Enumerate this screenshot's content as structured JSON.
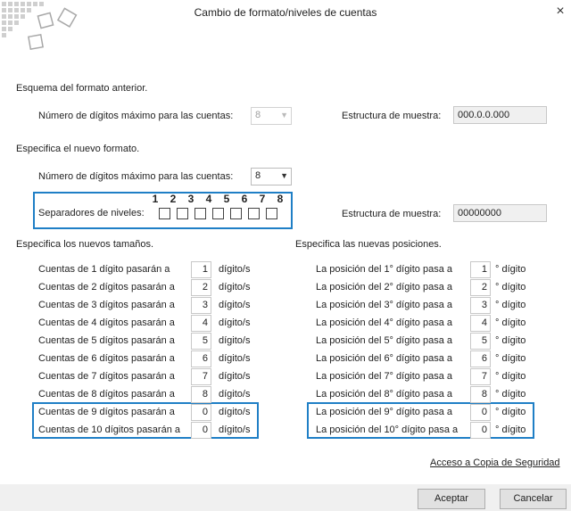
{
  "window": {
    "title": "Cambio de formato/niveles de cuentas",
    "close_glyph": "×"
  },
  "old_format": {
    "section_title": "Esquema del formato anterior.",
    "max_digits_label": "Número de dígitos máximo para las cuentas:",
    "max_digits_value": "8",
    "sample_label": "Estructura de muestra:",
    "sample_value": "000.0.0.000"
  },
  "new_format": {
    "section_title": "Especifica el nuevo formato.",
    "max_digits_label": "Número de dígitos máximo para las cuentas:",
    "max_digits_value": "8",
    "separators_label": "Separadores de niveles:",
    "level_numbers": [
      "1",
      "2",
      "3",
      "4",
      "5",
      "6",
      "7",
      "8"
    ],
    "sample_label": "Estructura de muestra:",
    "sample_value": "00000000"
  },
  "sizes": {
    "section_title": "Especifica los nuevos tamaños.",
    "unit": "dígito/s",
    "rows": [
      {
        "label": "Cuentas de 1 dígito pasarán a",
        "value": "1"
      },
      {
        "label": "Cuentas de 2 dígitos pasarán a",
        "value": "2"
      },
      {
        "label": "Cuentas de 3 dígitos pasarán a",
        "value": "3"
      },
      {
        "label": "Cuentas de 4 dígitos pasarán a",
        "value": "4"
      },
      {
        "label": "Cuentas de 5 dígitos pasarán a",
        "value": "5"
      },
      {
        "label": "Cuentas de 6 dígitos pasarán a",
        "value": "6"
      },
      {
        "label": "Cuentas de 7 dígitos pasarán a",
        "value": "7"
      },
      {
        "label": "Cuentas de 8 dígitos pasarán a",
        "value": "8"
      },
      {
        "label": "Cuentas de 9 dígitos pasarán a",
        "value": "0"
      },
      {
        "label": "Cuentas de 10 dígitos pasarán a",
        "value": "0"
      }
    ]
  },
  "positions": {
    "section_title": "Especifica las nuevas posiciones.",
    "unit": "° dígito",
    "rows": [
      {
        "label": "La posición del 1° dígito pasa a",
        "value": "1"
      },
      {
        "label": "La posición del 2° dígito pasa a",
        "value": "2"
      },
      {
        "label": "La posición del 3° dígito pasa a",
        "value": "3"
      },
      {
        "label": "La posición del 4° dígito pasa a",
        "value": "4"
      },
      {
        "label": "La posición del 5° dígito pasa a",
        "value": "5"
      },
      {
        "label": "La posición del 6° dígito pasa a",
        "value": "6"
      },
      {
        "label": "La posición del 7° dígito pasa a",
        "value": "7"
      },
      {
        "label": "La posición del 8° dígito pasa a",
        "value": "8"
      },
      {
        "label": "La posición del 9° dígito pasa a",
        "value": "0"
      },
      {
        "label": "La posición del 10° dígito pasa a",
        "value": "0"
      }
    ]
  },
  "footer": {
    "backup_link": "Acceso a Copia de Seguridad",
    "accept": "Aceptar",
    "cancel": "Cancelar"
  },
  "colors": {
    "highlight": "#1f7fc6",
    "footer_bg": "#f0f0f0"
  }
}
